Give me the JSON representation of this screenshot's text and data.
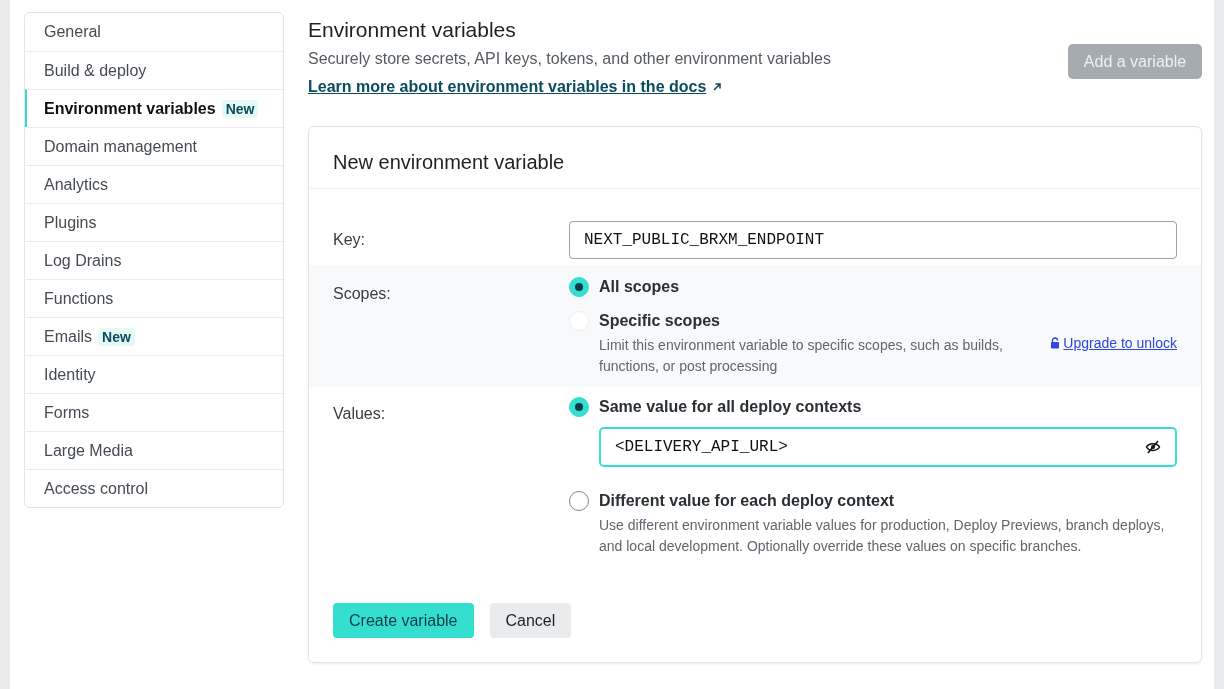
{
  "sidebar": {
    "items": [
      {
        "label": "General",
        "selected": false
      },
      {
        "label": "Build & deploy",
        "selected": false
      },
      {
        "label": "Environment variables",
        "selected": true,
        "badge": "New"
      },
      {
        "label": "Domain management",
        "selected": false
      },
      {
        "label": "Analytics",
        "selected": false
      },
      {
        "label": "Plugins",
        "selected": false
      },
      {
        "label": "Log Drains",
        "selected": false
      },
      {
        "label": "Functions",
        "selected": false
      },
      {
        "label": "Emails",
        "selected": false,
        "badge": "New"
      },
      {
        "label": "Identity",
        "selected": false
      },
      {
        "label": "Forms",
        "selected": false
      },
      {
        "label": "Large Media",
        "selected": false
      },
      {
        "label": "Access control",
        "selected": false
      }
    ]
  },
  "header": {
    "title": "Environment variables",
    "description": "Securely store secrets, API keys, tokens, and other environment variables",
    "link": "Learn more about environment variables in the docs",
    "add_button": {
      "label": "Add a variable",
      "disabled": true
    }
  },
  "form": {
    "title": "New environment variable",
    "key": {
      "label": "Key:",
      "value": "NEXT_PUBLIC_BRXM_ENDPOINT"
    },
    "scopes": {
      "label": "Scopes:",
      "options": [
        {
          "label": "All scopes",
          "selected": true,
          "disabled": false
        },
        {
          "label": "Specific scopes",
          "selected": false,
          "disabled": true,
          "description": "Limit this environment variable to specific scopes, such as builds, functions, or post processing",
          "upgrade_link": "Upgrade to unlock"
        }
      ]
    },
    "values": {
      "label": "Values:",
      "options": [
        {
          "label": "Same value for all deploy contexts",
          "selected": true,
          "value": "<DELIVERY_API_URL>"
        },
        {
          "label": "Different value for each deploy context",
          "selected": false,
          "description": "Use different environment variable values for production, Deploy Previews, branch deploys, and local development. Optionally override these values on specific branches."
        }
      ]
    },
    "buttons": [
      {
        "label": "Create variable",
        "kind": "primary"
      },
      {
        "label": "Cancel",
        "kind": "secondary"
      }
    ]
  }
}
